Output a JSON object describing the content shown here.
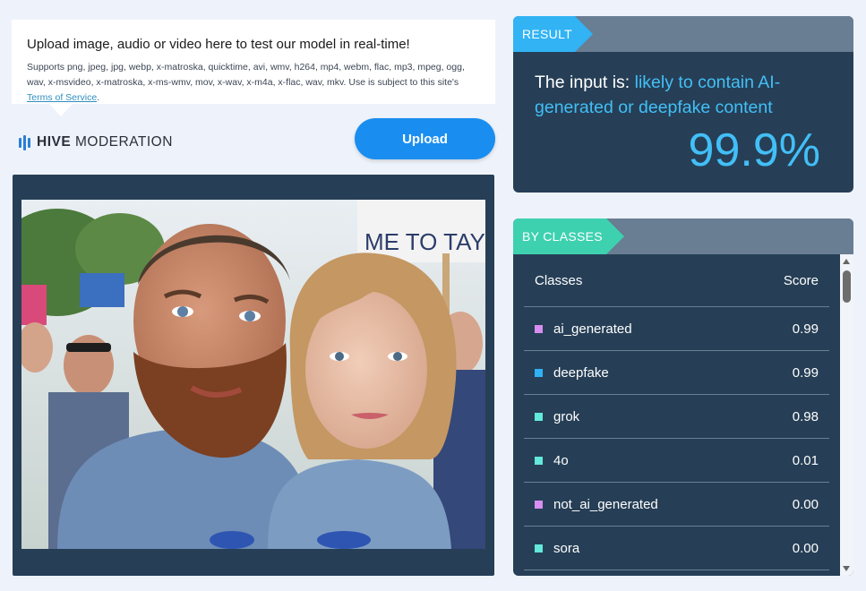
{
  "upload_info": {
    "title": "Upload image, audio or video here to test our model in real-time!",
    "supports_text": "Supports png, jpeg, jpg, webp, x-matroska, quicktime, avi, wmv, h264, mp4, webm, flac, mp3, mpeg, ogg, wav, x-msvideo, x-matroska, x-ms-wmv, mov, x-wav, x-m4a, x-flac, wav, mkv. Use is subject to this site's",
    "terms_link": "Terms of Service",
    "terms_suffix": "."
  },
  "logo": {
    "bold": "HIVE",
    "light": "MODERATION"
  },
  "upload_button": {
    "label": "Upload"
  },
  "image": {
    "sign_text": "ME TO TAYLR FOR"
  },
  "result": {
    "tab_label": "RESULT",
    "prefix": "The input is: ",
    "verdict": "likely to contain AI-generated or deepfake content",
    "percentage": "99.9%"
  },
  "classes": {
    "tab_label": "BY CLASSES",
    "header_class": "Classes",
    "header_score": "Score",
    "rows": [
      {
        "name": "ai_generated",
        "score": "0.99",
        "color": "#d88ef0"
      },
      {
        "name": "deepfake",
        "score": "0.99",
        "color": "#2fb1f6"
      },
      {
        "name": "grok",
        "score": "0.98",
        "color": "#62e9d9"
      },
      {
        "name": "4o",
        "score": "0.01",
        "color": "#62e9d9"
      },
      {
        "name": "not_ai_generated",
        "score": "0.00",
        "color": "#d88ef0"
      },
      {
        "name": "sora",
        "score": "0.00",
        "color": "#62e9d9"
      }
    ]
  },
  "colors": {
    "background": "#eef3fb",
    "panel": "#263f56",
    "accent_blue": "#42bff7",
    "upload_button": "#1a8ef0",
    "classes_tab": "#3ed1b0"
  }
}
